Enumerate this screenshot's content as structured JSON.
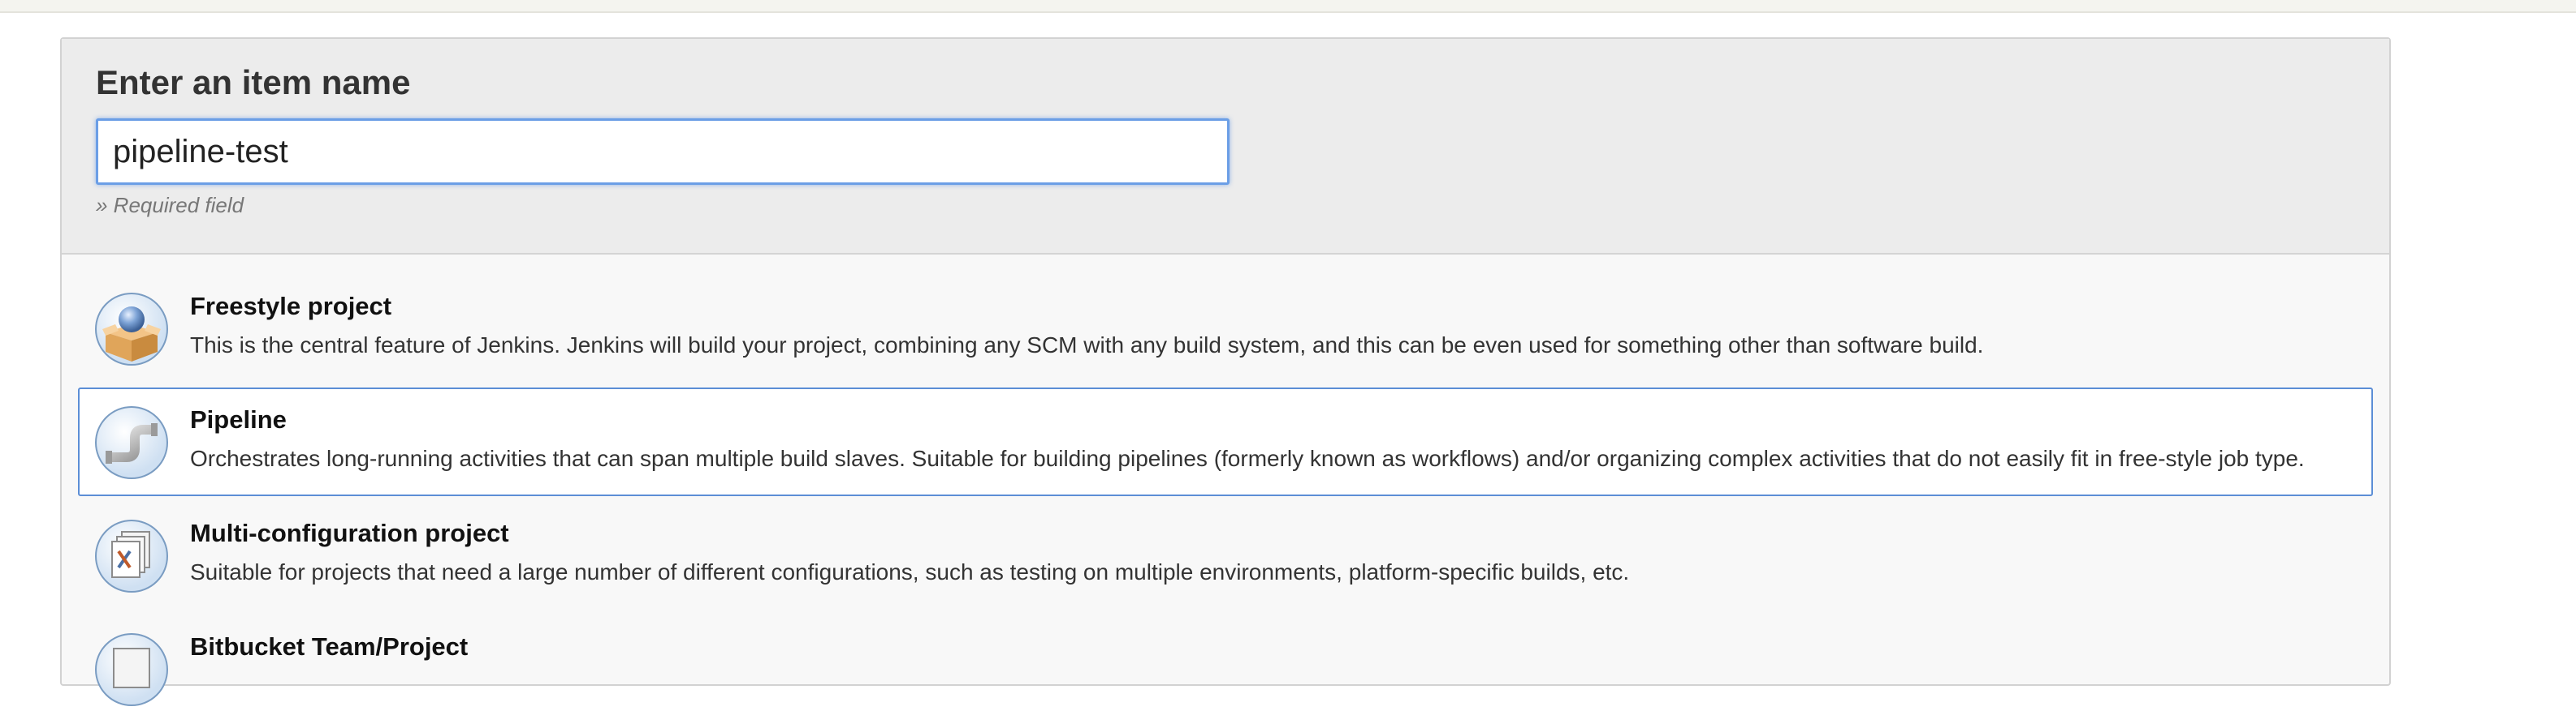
{
  "item_name": {
    "heading": "Enter an item name",
    "value": "pipeline-test",
    "required_hint": "» Required field"
  },
  "item_types": [
    {
      "title": "Freestyle project",
      "description": "This is the central feature of Jenkins. Jenkins will build your project, combining any SCM with any build system, and this can be even used for something other than software build.",
      "icon": "freestyle-project-icon",
      "selected": false
    },
    {
      "title": "Pipeline",
      "description": "Orchestrates long-running activities that can span multiple build slaves. Suitable for building pipelines (formerly known as workflows) and/or organizing complex activities that do not easily fit in free-style job type.",
      "icon": "pipeline-icon",
      "selected": true
    },
    {
      "title": "Multi-configuration project",
      "description": "Suitable for projects that need a large number of different configurations, such as testing on multiple environments, platform-specific builds, etc.",
      "icon": "multi-configuration-icon",
      "selected": false
    },
    {
      "title": "Bitbucket Team/Project",
      "description": "",
      "icon": "bitbucket-team-icon",
      "selected": false
    }
  ],
  "colors": {
    "selection_border": "#5c8ed6",
    "input_focus": "#6b9ee6",
    "header_bg": "#ececec",
    "list_bg": "#f8f8f8"
  }
}
